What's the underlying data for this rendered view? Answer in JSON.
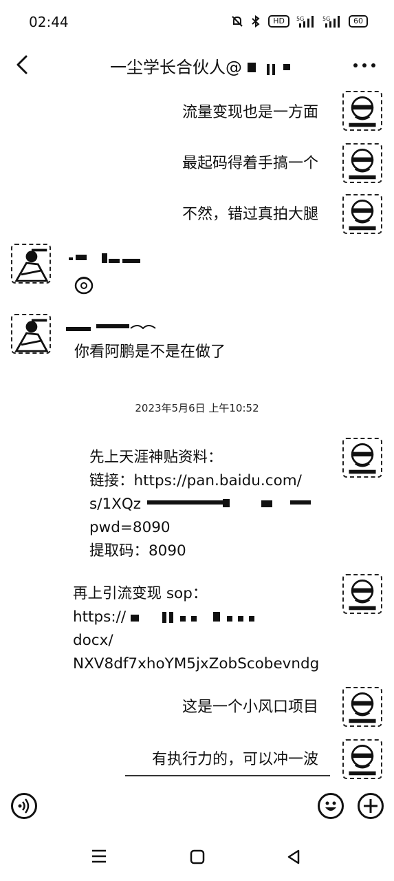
{
  "status": {
    "time": "02:44",
    "battery": "60",
    "hd_label": "HD",
    "signal1": "5G",
    "signal2": "5G"
  },
  "header": {
    "title": "一尘学长合伙人@"
  },
  "messages": {
    "out1": "流量变现也是一方面",
    "out2": "最起码得着手搞一个",
    "out3": "不然，错过真拍大腿",
    "in2": "你看阿鹏是不是在做了",
    "timestamp": "2023年5月6日 上午10:52",
    "block1": {
      "line1": "先上天涯神贴资料：",
      "line2": "链接：https://pan.baidu.com/",
      "line3": "s/1XQz",
      "line4": "pwd=8090",
      "line5": "提取码：8090"
    },
    "block2": {
      "line1": "再上引流变现 sop：",
      "line2": "https://",
      "line3": "docx/",
      "line4": "NXV8df7xhoYM5jxZobScobevndg"
    },
    "out4": "这是一个小风口项目",
    "out5": "有执行力的，可以冲一波"
  }
}
